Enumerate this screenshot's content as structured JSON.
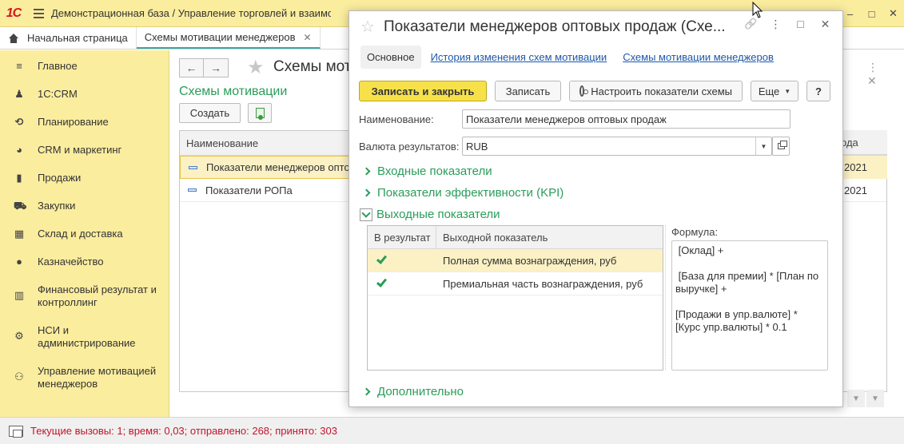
{
  "app": {
    "logo": "1С",
    "title": "Демонстрационная база / Управление торговлей и взаимо",
    "window_controls": [
      "–",
      "□",
      "✕"
    ]
  },
  "tabs": [
    {
      "label": "Начальная страница"
    },
    {
      "label": "Схемы мотивации менеджеров",
      "close": "✕"
    }
  ],
  "sidebar": {
    "items": [
      {
        "label": "Главное",
        "icon": "menu-lines-icon"
      },
      {
        "label": "1С:CRM",
        "icon": "crm-person-icon"
      },
      {
        "label": "Планирование",
        "icon": "planning-icon"
      },
      {
        "label": "CRM и маркетинг",
        "icon": "pie-chart-icon"
      },
      {
        "label": "Продажи",
        "icon": "shopping-bag-icon"
      },
      {
        "label": "Закупки",
        "icon": "cart-icon"
      },
      {
        "label": "Склад и доставка",
        "icon": "warehouse-icon"
      },
      {
        "label": "Казначейство",
        "icon": "coin-icon"
      },
      {
        "label": "Финансовый результат и контроллинг",
        "icon": "bar-chart-icon"
      },
      {
        "label": "НСИ и администрирование",
        "icon": "gear-icon"
      },
      {
        "label": "Управление мотивацией менеджеров",
        "icon": "people-icon"
      }
    ]
  },
  "main": {
    "title": "Схемы мот",
    "link": "Схемы мотивации",
    "create_button": "Создать",
    "nav_back": "←",
    "nav_forward": "→",
    "table": {
      "header": "Наименование",
      "right_header": "ода",
      "rows": [
        {
          "name": "Показатели менеджеров опто",
          "year": "2021"
        },
        {
          "name": "Показатели РОПа",
          "year": "2021"
        }
      ]
    }
  },
  "modal": {
    "title": "Показатели менеджеров оптовых продаж (Схе...",
    "controls": [
      "🔗",
      "⋮",
      "□",
      "✕"
    ],
    "nav_tabs": [
      {
        "label": "Основное"
      },
      {
        "label": "История изменения схем мотивации"
      },
      {
        "label": "Схемы мотивации менеджеров"
      }
    ],
    "toolbar": {
      "save_close": "Записать и закрыть",
      "save": "Записать",
      "configure": "Настроить показатели схемы",
      "more": "Еще",
      "help": "?"
    },
    "fields": {
      "name_label": "Наименование:",
      "name_value": "Показатели менеджеров оптовых продаж",
      "currency_label": "Валюта результатов:",
      "currency_value": "RUB"
    },
    "groups": {
      "input": "Входные показатели",
      "kpi": "Показатели эффективности (KPI)",
      "output": "Выходные показатели",
      "extra": "Дополнительно"
    },
    "output_table": {
      "col1": "В результат",
      "col2": "Выходной показатель",
      "rows": [
        {
          "label": "Полная сумма вознаграждения, руб",
          "checked": true
        },
        {
          "label": "Премиальная часть вознаграждения, руб",
          "checked": true
        }
      ]
    },
    "formula": {
      "label": "Формула:",
      "text": " [Оклад] +\n\n [База для премии] * [План по выручке] +\n\n[Продажи в упр.валюте] * [Курс упр.валюты] * 0.1"
    }
  },
  "status": {
    "text": "Текущие вызовы: 1; время: 0,03; отправлено: 268; принято: 303"
  },
  "colors": {
    "accent_yellow": "#fbed9e",
    "link_green": "#2a9d5a",
    "link_blue": "#1e58a8",
    "status_red": "#c0152a",
    "primary_button": "#f7e14b"
  }
}
